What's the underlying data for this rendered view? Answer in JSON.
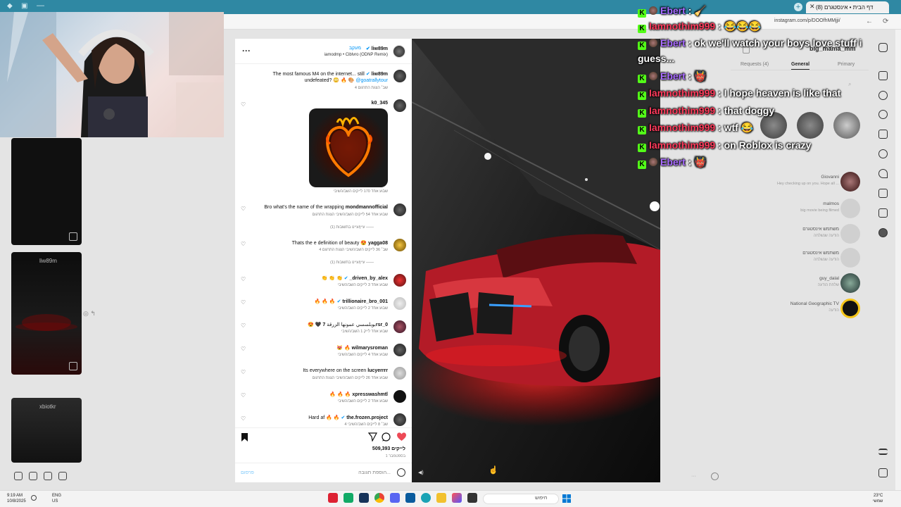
{
  "browser": {
    "tab_title": "(8) דף הבית • אינסטגרם",
    "url": "instagram.com/p/DOOfhMMjji/"
  },
  "post": {
    "username": "liw89m",
    "follow_label": "מעקב",
    "audio": "iamodmp • Ciblvro (ODNP Remix)",
    "caption_user": "liw89m",
    "caption_text": "The most famous M4 on the internet... still",
    "caption_line2": "undefeated? 😳 🔥 🎨",
    "caption_tag": "@goatrallytour",
    "caption_meta": "4 שב׳   הצגת התרגום",
    "likes": "509,393 לייקים",
    "date": "1 בספטמבר",
    "comment_placeholder": "הוספת תגובה...",
    "publish_label": "פרסום"
  },
  "comments": [
    {
      "user": "k0_345",
      "text": "",
      "meta": "שבוע אחד   170 לייקים   השב/השיבי"
    },
    {
      "user": "mondmannofficial",
      "text": "Bro what's the name of the wrapping",
      "meta": "שבוע אחד   54 לייקים   השב/השיבי   הצגת התרגום",
      "replies": "עיין/עיינו בתשובות (1)"
    },
    {
      "user": "yagga08",
      "text": "Thats the e definition of beauty 😍",
      "meta": "4 שב׳   36 לייקים   השב/השיבי   הצגת התרגום",
      "replies": "עיין/עיינו בתשובות (1)"
    },
    {
      "user": "_driven_by_alex",
      "text": "👏 👏 👏",
      "meta": "שבוע אחד   3 לייקים   השב/השיבי"
    },
    {
      "user": "trillionaire_bro_001",
      "text": "🔥 🔥 🔥",
      "meta": "שבוע אחד   2 לייקים   השב/השיבי"
    },
    {
      "user": "7rsr_0",
      "text": "😍 🖤 بوبلسسي عمونها الزرقة",
      "meta": "שבוע אחד   לייק 1   השב/השיבי"
    },
    {
      "user": "wilmarysroman",
      "text": "😻 🔥",
      "meta": "שבוע אחד   4 לייקים   השב/השיבי"
    },
    {
      "user": "lucyerrrr",
      "text": "Its everywhere on the screen",
      "meta": "שבוע אחד   26 לייקים   השב/השיבי   הצגת התרגום"
    },
    {
      "user": "xpresswashmtl",
      "text": "🔥 🔥 🔥",
      "meta": "שבוע אחד   2 לייקים   השב/השיבי"
    },
    {
      "user": "the.frozen.project",
      "text": "Hard af 🔥 🔥",
      "meta": "4 שב׳   8 לייקים   השב/השיבי"
    }
  ],
  "chat": [
    {
      "name": "Ebert",
      "sep": ":",
      "msg": "🧹",
      "color": "#a86bff"
    },
    {
      "name": "Iamnothim999",
      "sep": ":",
      "msg": "😂😂😂",
      "color": "#ff3b5c"
    },
    {
      "name": "Ebert",
      "sep": ":",
      "msg": "ok we'll watch your boys love stuff i guess...",
      "color": "#a86bff"
    },
    {
      "name": "Ebert",
      "sep": ":",
      "msg": "👹",
      "color": "#a86bff"
    },
    {
      "name": "Iamnothim999",
      "sep": ":",
      "msg": "I hope heaven is like that",
      "color": "#ff3b5c"
    },
    {
      "name": "Iamnothim999",
      "sep": ":",
      "msg": "that doggy",
      "color": "#ff3b5c"
    },
    {
      "name": "Iamnothim999",
      "sep": ":",
      "msg": "wtf 😂",
      "color": "#ff3b5c"
    },
    {
      "name": "Iamnothim999",
      "sep": ":",
      "msg": "on Roblox is crazy",
      "color": "#ff3b5c"
    },
    {
      "name": "Ebert",
      "sep": ":",
      "msg": "👹",
      "color": "#a86bff"
    }
  ],
  "dm": {
    "username": "big_mama_mm",
    "tabs": {
      "requests": "Requests (4)",
      "general": "General",
      "primary": "Primary"
    },
    "rows": [
      {
        "name": "Giovanni",
        "msg": "Hey checking up on you. Hope all ..."
      },
      {
        "name": "malmos",
        "msg": "big movie being filmed"
      },
      {
        "name": "משתמש אינסטגרם",
        "msg": "הודעה שנשלחה"
      },
      {
        "name": "משתמש אינסטגרם",
        "msg": "הודעה שנשלחה"
      },
      {
        "name": "guy_dalal",
        "msg": "שלחת הודעה"
      },
      {
        "name": "National Geographic TV",
        "msg": "הודעה"
      }
    ]
  },
  "left": {
    "reel_user_1": "liw89m",
    "reel_user_2": "xbiotkr"
  },
  "taskbar": {
    "time": "9:19 AM",
    "date": "10/8/2025",
    "lang1": "ENG",
    "lang2": "US",
    "search": "חיפוש",
    "temp": "23°C",
    "weather": "שמשי"
  },
  "colors": {
    "accent": "#0095f6",
    "chat_green": "#53fc18",
    "browser_teal": "#2f88a3",
    "heart": "#ed4956"
  }
}
